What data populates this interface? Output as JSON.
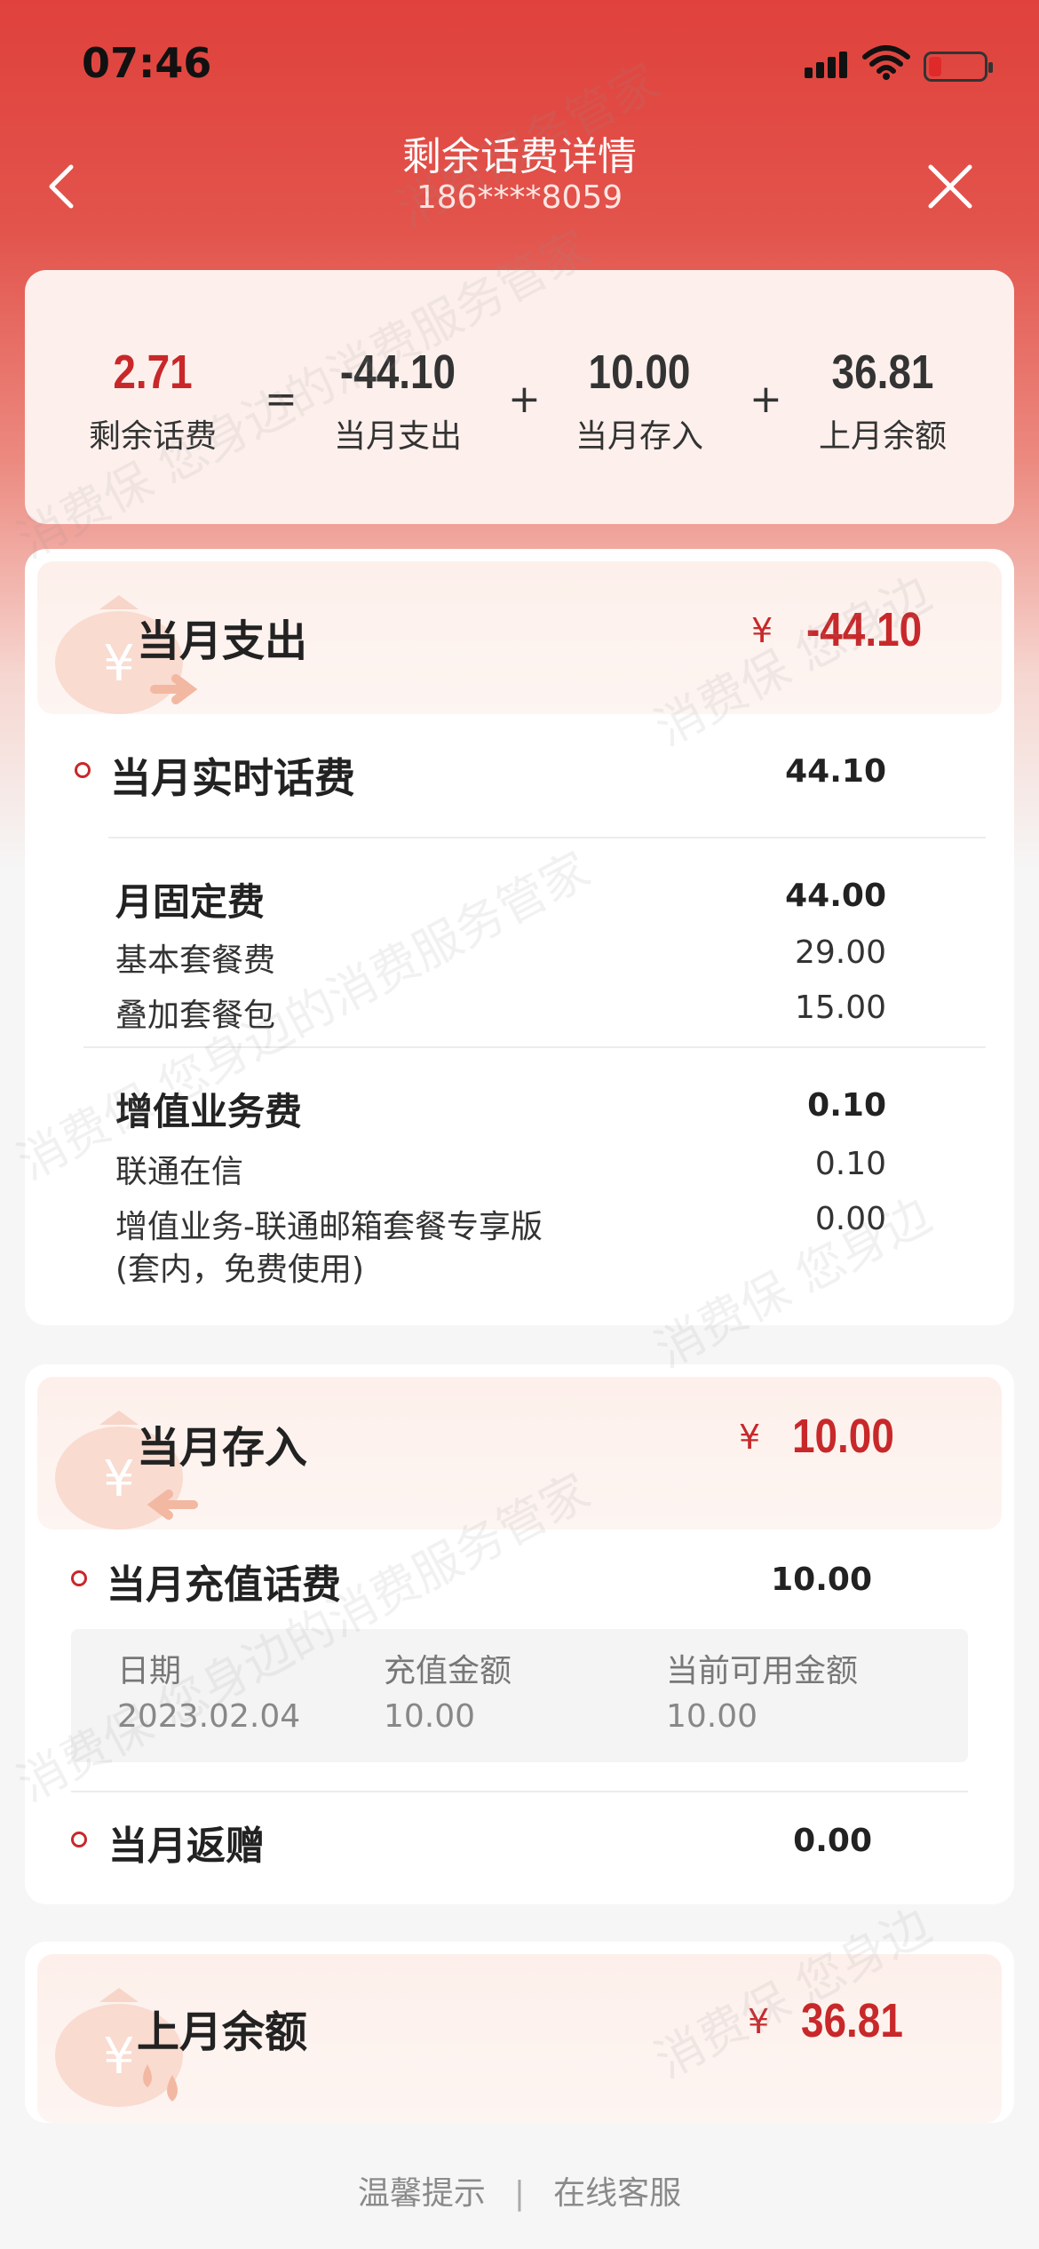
{
  "status": {
    "time": "07:46"
  },
  "nav": {
    "title": "剩余话费详情",
    "phone": "186****8059"
  },
  "summary": {
    "remaining": {
      "value": "2.71",
      "label": "剩余话费"
    },
    "eq": "=",
    "expense": {
      "value": "-44.10",
      "label": "当月支出"
    },
    "plus1": "+",
    "deposit": {
      "value": "10.00",
      "label": "当月存入"
    },
    "plus2": "+",
    "last_balance": {
      "value": "36.81",
      "label": "上月余额"
    }
  },
  "expense_card": {
    "title": "当月支出",
    "currency": "¥",
    "amount": "-44.10",
    "realtime": {
      "label": "当月实时话费",
      "value": "44.10"
    },
    "fixed": {
      "title": "月固定费",
      "total": "44.00",
      "items": [
        {
          "label": "基本套餐费",
          "value": "29.00"
        },
        {
          "label": "叠加套餐包",
          "value": "15.00"
        }
      ]
    },
    "vas": {
      "title": "增值业务费",
      "total": "0.10",
      "items": [
        {
          "label": "联通在信",
          "value": "0.10"
        },
        {
          "label": "增值业务-联通邮箱套餐专享版",
          "label2": "(套内，免费使用)",
          "value": "0.00"
        }
      ]
    }
  },
  "deposit_card": {
    "title": "当月存入",
    "currency": "¥",
    "amount": "10.00",
    "recharge": {
      "label": "当月充值话费",
      "value": "10.00"
    },
    "table": {
      "headers": [
        "日期",
        "充值金额",
        "当前可用金额"
      ],
      "row": [
        "2023.02.04",
        "10.00",
        "10.00"
      ]
    },
    "rebate": {
      "label": "当月返赠",
      "value": "0.00"
    }
  },
  "balance_card": {
    "title": "上月余额",
    "currency": "¥",
    "amount": "36.81"
  },
  "footer": {
    "tips": "温馨提示",
    "sep": "|",
    "service": "在线客服"
  },
  "colors": {
    "brand_red": "#e0413c",
    "amount_red": "#c8282a"
  },
  "icons": [
    "back-icon",
    "close-icon",
    "money-bag-out-icon",
    "money-bag-in-icon",
    "money-bag-drop-icon"
  ]
}
